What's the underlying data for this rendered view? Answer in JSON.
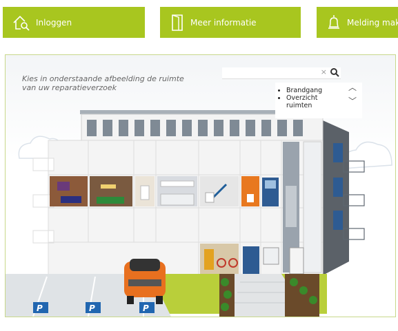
{
  "nav": {
    "login_label": "Inloggen",
    "info_label": "Meer informatie",
    "report_label": "Melding maken"
  },
  "panel": {
    "instruction": "Kies in onderstaande afbeelding de ruimte van uw reparatieverzoek",
    "search": {
      "placeholder": "",
      "clear": "×"
    },
    "rooms": [
      "Brandgang",
      "Overzicht ruimten"
    ]
  },
  "parking": {
    "sign": "P"
  },
  "colors": {
    "nav_green": "#a8c61f",
    "car_orange": "#e8701f",
    "door_blue": "#2e5b92",
    "roof": "#8a949e"
  }
}
